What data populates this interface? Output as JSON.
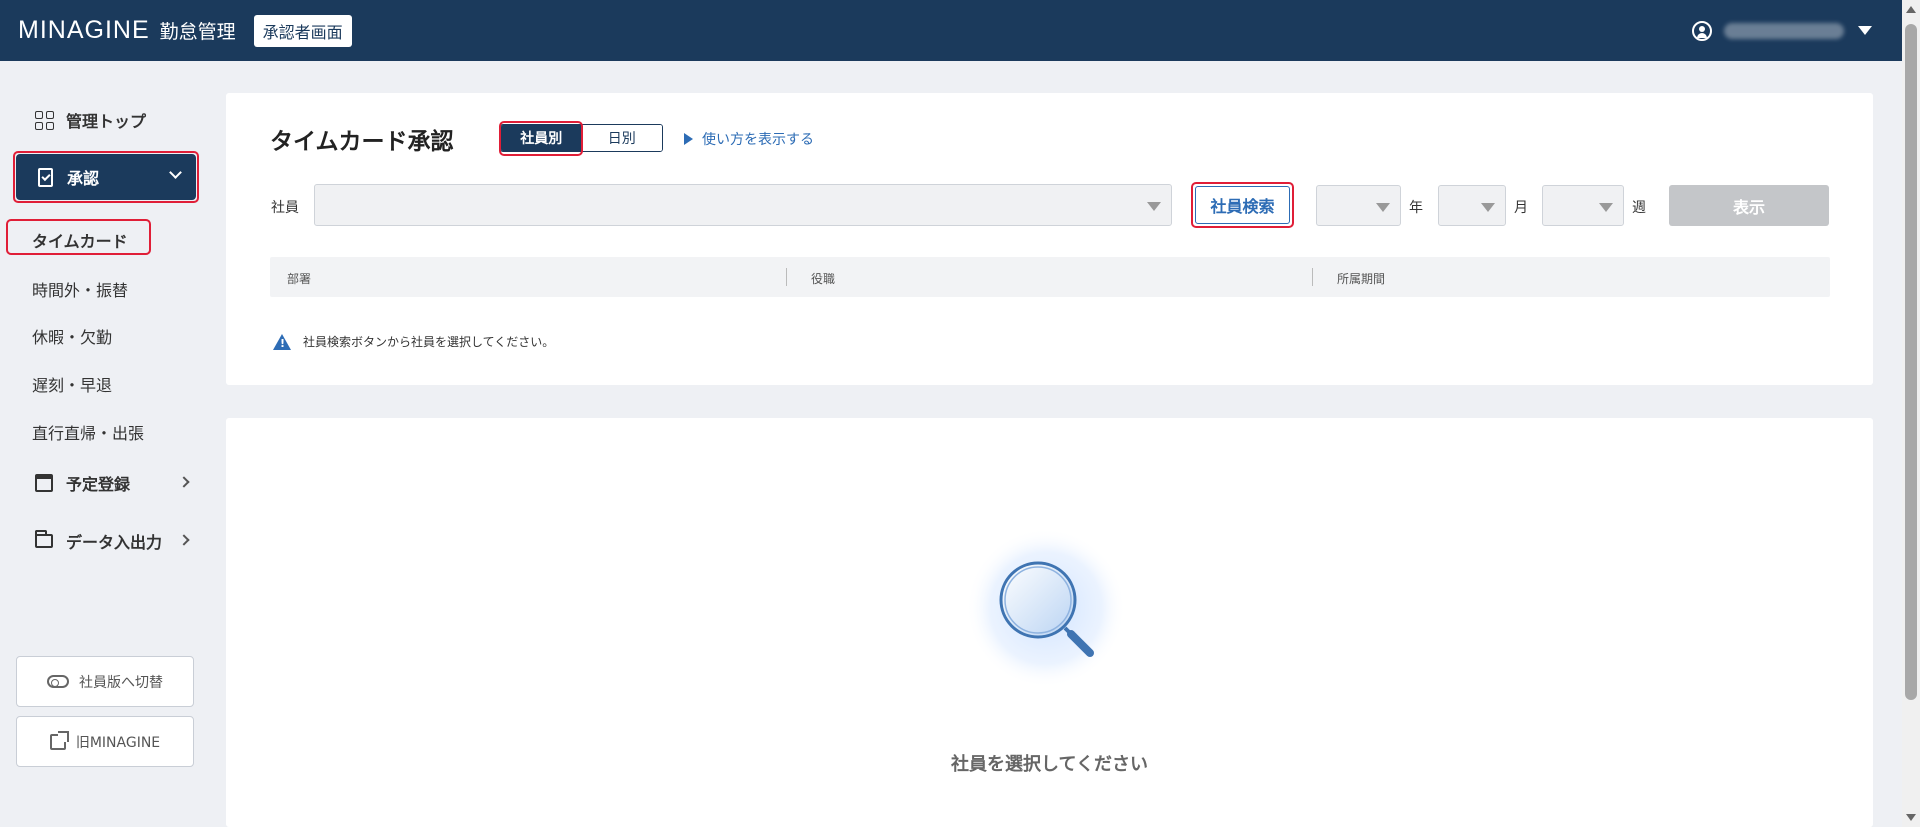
{
  "header": {
    "logo": "MINAGINE",
    "logo_sub": "勤怠管理",
    "role_badge": "承認者画面"
  },
  "sidebar": {
    "top_item": "管理トップ",
    "approve": "承認",
    "sub_items": [
      "タイムカード",
      "時間外・振替",
      "休暇・欠勤",
      "遅刻・早退",
      "直行直帰・出張"
    ],
    "schedule": "予定登録",
    "data_io": "データ入出力",
    "switch_employee": "社員版へ切替",
    "old_minagine": "旧MINAGINE"
  },
  "main": {
    "title": "タイムカード承認",
    "seg_employee": "社員別",
    "seg_daily": "日別",
    "howto": "使い方を表示する",
    "employee_label": "社員",
    "employee_search": "社員検索",
    "year_unit": "年",
    "month_unit": "月",
    "week_unit": "週",
    "show": "表示",
    "info_columns": [
      "部署",
      "役職",
      "所属期間"
    ],
    "notice": "社員検索ボタンから社員を選択してください。",
    "empty_text": "社員を選択してください"
  },
  "icons": {
    "accent": "#1b3a5c",
    "link": "#2d6cb5",
    "highlight": "#e01e37"
  }
}
